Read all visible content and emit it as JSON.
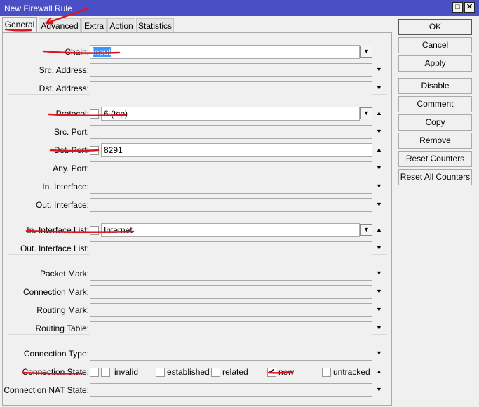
{
  "window": {
    "title": "New Firewall Rule",
    "maximize_icon": "□",
    "close_icon": "✕"
  },
  "tabs": [
    "General",
    "Advanced",
    "Extra",
    "Action",
    "Statistics"
  ],
  "buttons": [
    "OK",
    "Cancel",
    "Apply",
    "Disable",
    "Comment",
    "Copy",
    "Remove",
    "Reset Counters",
    "Reset All Counters"
  ],
  "rows": [
    {
      "label": "Chain:",
      "value": "input",
      "selected": true,
      "dropdown": true
    },
    {
      "label": "Src. Address:",
      "arrow": "down"
    },
    {
      "label": "Dst. Address:",
      "arrow": "down"
    },
    {
      "label": "Protocol:",
      "checkbox": true,
      "value": "6 (tcp)",
      "dropdown": true,
      "arrow": "up"
    },
    {
      "label": "Src. Port:",
      "arrow": "down"
    },
    {
      "label": "Dst. Port:",
      "checkbox": true,
      "value": "8291",
      "arrow": "up"
    },
    {
      "label": "Any. Port:",
      "arrow": "down"
    },
    {
      "label": "In. Interface:",
      "arrow": "down"
    },
    {
      "label": "Out. Interface:",
      "arrow": "down"
    },
    {
      "label": "In. Interface List:",
      "checkbox": true,
      "value": "Internet",
      "dropdown": true,
      "arrow": "up"
    },
    {
      "label": "Out. Interface List:",
      "arrow": "down"
    },
    {
      "label": "Packet Mark:",
      "arrow": "down"
    },
    {
      "label": "Connection Mark:",
      "arrow": "down"
    },
    {
      "label": "Routing Mark:",
      "arrow": "down"
    },
    {
      "label": "Routing Table:",
      "arrow": "down"
    },
    {
      "label": "Connection Type:",
      "arrow": "down"
    },
    {
      "label": "Connection State:",
      "states": [
        {
          "label": "invalid",
          "checked": false
        },
        {
          "label": "established",
          "checked": false
        },
        {
          "label": "related",
          "checked": false
        },
        {
          "label": "new",
          "checked": true
        },
        {
          "label": "untracked",
          "checked": false
        }
      ],
      "arrow": "up"
    },
    {
      "label": "Connection NAT State:",
      "arrow": "down"
    }
  ]
}
